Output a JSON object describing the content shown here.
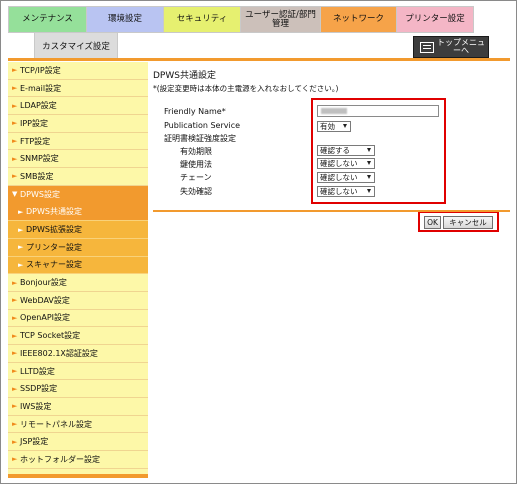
{
  "tabs": [
    {
      "label": "メンテナンス",
      "color": "#95e09a"
    },
    {
      "label": "環境設定",
      "color": "#b9c4f2"
    },
    {
      "label": "セキュリティ",
      "color": "#e6f070"
    },
    {
      "label": "ユーザー認証/部門管理",
      "color": "#ccc0ba"
    },
    {
      "label": "ネットワーク",
      "color": "#f6a349"
    },
    {
      "label": "プリンター設定",
      "color": "#f4b6c6"
    }
  ],
  "subtab": {
    "label": "カスタマイズ設定"
  },
  "topmenu": {
    "label": "トップメニューへ"
  },
  "sidebar": {
    "items": [
      {
        "label": "TCP/IP設定"
      },
      {
        "label": "E-mail設定"
      },
      {
        "label": "LDAP設定"
      },
      {
        "label": "IPP設定"
      },
      {
        "label": "FTP設定"
      },
      {
        "label": "SNMP設定"
      },
      {
        "label": "SMB設定"
      },
      {
        "label": "DPWS設定"
      },
      {
        "label": "DPWS共通設定"
      },
      {
        "label": "DPWS拡張設定"
      },
      {
        "label": "プリンター設定"
      },
      {
        "label": "スキャナー設定"
      },
      {
        "label": "Bonjour設定"
      },
      {
        "label": "WebDAV設定"
      },
      {
        "label": "OpenAPI設定"
      },
      {
        "label": "TCP Socket設定"
      },
      {
        "label": "IEEE802.1X認証設定"
      },
      {
        "label": "LLTD設定"
      },
      {
        "label": "SSDP設定"
      },
      {
        "label": "IWS設定"
      },
      {
        "label": "リモートパネル設定"
      },
      {
        "label": "JSP設定"
      },
      {
        "label": "ホットフォルダー設定"
      }
    ]
  },
  "main": {
    "title": "DPWS共通設定",
    "note": "*(設定変更時は本体の主電源を入れなおしてください。)",
    "friendly_name_label": "Friendly Name*",
    "publication_service_label": "Publication Service",
    "publication_service_value": "有効",
    "cert_section_label": "証明書検証強度設定",
    "cert_rows": [
      {
        "label": "有効期限",
        "value": "確認する"
      },
      {
        "label": "鍵使用法",
        "value": "確認しない"
      },
      {
        "label": "チェーン",
        "value": "確認しない"
      },
      {
        "label": "失効確認",
        "value": "確認しない"
      }
    ],
    "ok_label": "OK",
    "cancel_label": "キャンセル"
  },
  "colors": {
    "accent": "#f29a2e",
    "sidebar_bg": "#fdf8a8",
    "highlight": "#e00000"
  }
}
